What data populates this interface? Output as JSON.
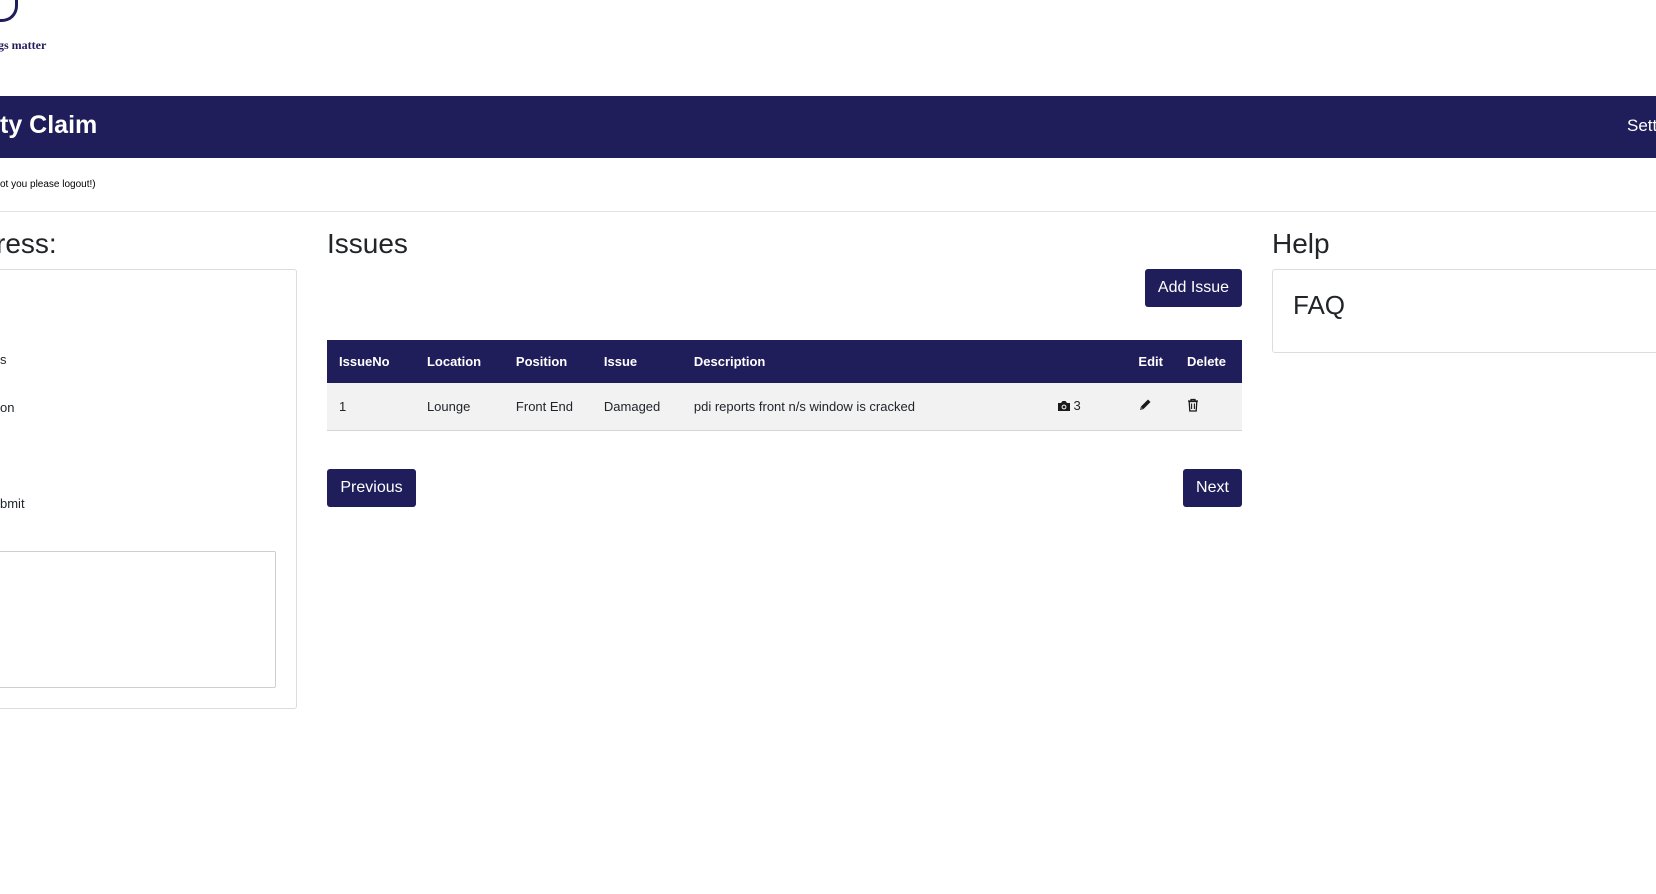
{
  "brand": {
    "tagline": "gs matter"
  },
  "navbar": {
    "title": "ty Claim",
    "settings_label": "Sett"
  },
  "user_note": "ot you please logout!)",
  "progress": {
    "title": "ress:",
    "steps": [
      "s",
      "on",
      "bmit"
    ]
  },
  "issues": {
    "title": "Issues",
    "add_label": "Add Issue",
    "columns": [
      "IssueNo",
      "Location",
      "Position",
      "Issue",
      "Description",
      "",
      "Edit",
      "Delete"
    ],
    "rows": [
      {
        "issue_no": "1",
        "location": "Lounge",
        "position": "Front End",
        "issue": "Damaged",
        "description": "pdi reports front n/s window is cracked",
        "photo_count": "3"
      }
    ],
    "previous_label": "Previous",
    "next_label": "Next"
  },
  "help": {
    "title": "Help",
    "faq_label": "FAQ"
  },
  "colors": {
    "brand": "#1f1d5a",
    "row_bg": "#f2f2f2"
  }
}
